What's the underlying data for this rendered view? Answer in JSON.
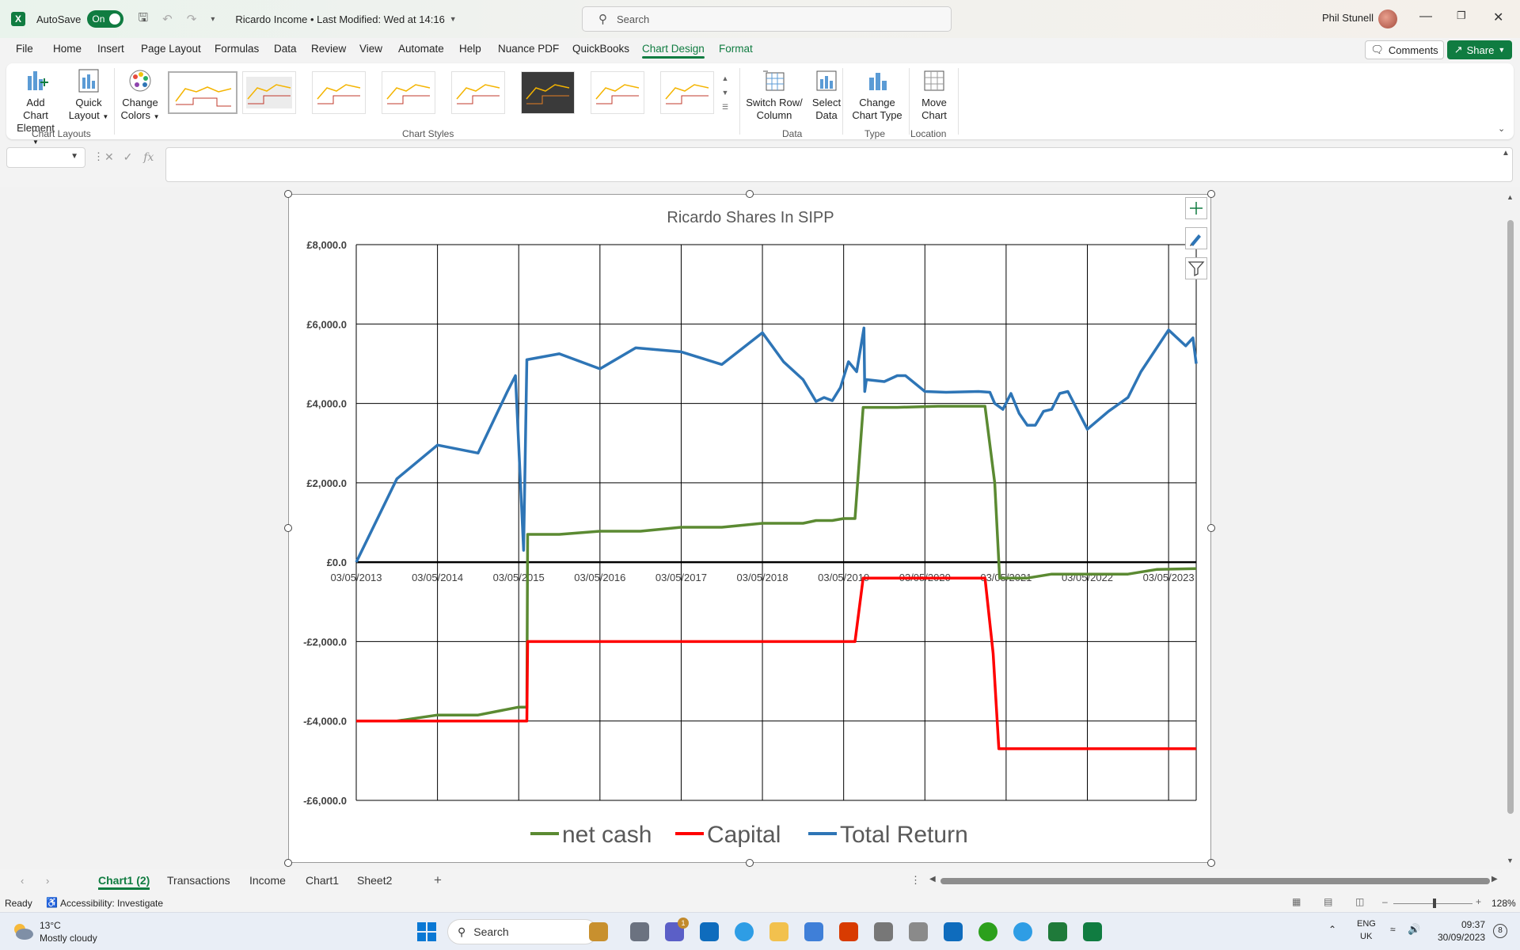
{
  "titlebar": {
    "autosave_label": "AutoSave",
    "autosave_state": "On",
    "doc_title": "Ricardo Income • Last Modified: Wed at 14:16",
    "search_placeholder": "Search",
    "user_name": "Phil Stunell"
  },
  "menu": {
    "tabs": [
      "File",
      "Home",
      "Insert",
      "Page Layout",
      "Formulas",
      "Data",
      "Review",
      "View",
      "Automate",
      "Help",
      "Nuance PDF",
      "QuickBooks",
      "Chart Design",
      "Format"
    ],
    "active_tab": "Chart Design",
    "comments_label": "Comments",
    "share_label": "Share"
  },
  "ribbon": {
    "add_chart_element": [
      "Add Chart",
      "Element"
    ],
    "quick_layout": [
      "Quick",
      "Layout"
    ],
    "change_colors": [
      "Change",
      "Colors"
    ],
    "switch_row_col": [
      "Switch Row/",
      "Column"
    ],
    "select_data": [
      "Select",
      "Data"
    ],
    "change_chart_type": [
      "Change",
      "Chart Type"
    ],
    "move_chart": [
      "Move",
      "Chart"
    ],
    "groups": {
      "chart_layouts": "Chart Layouts",
      "chart_styles": "Chart Styles",
      "data": "Data",
      "type": "Type",
      "location": "Location"
    }
  },
  "formula_bar": {
    "fx": "fx",
    "value": ""
  },
  "chart_data": {
    "type": "line",
    "title": "Ricardo Shares In SIPP",
    "x_tick_labels": [
      "03/05/2013",
      "03/05/2014",
      "03/05/2015",
      "03/05/2016",
      "03/05/2017",
      "03/05/2018",
      "03/05/2019",
      "03/05/2020",
      "03/05/2021",
      "03/05/2022",
      "03/05/2023"
    ],
    "y_tick_labels": [
      "£8,000.0",
      "£6,000.0",
      "£4,000.0",
      "£2,000.0",
      "£0.0",
      "-£2,000.0",
      "-£4,000.0",
      "-£6,000.0"
    ],
    "ylim": [
      -6000,
      8000
    ],
    "xlim": [
      2013.34,
      2023.68
    ],
    "grid": true,
    "legend_position": "bottom",
    "series": [
      {
        "name": "net cash",
        "color": "#5b8a32",
        "points": [
          [
            2013.34,
            -4000
          ],
          [
            2013.84,
            -4000
          ],
          [
            2014.34,
            -3850
          ],
          [
            2014.84,
            -3850
          ],
          [
            2015.34,
            -3650
          ],
          [
            2015.44,
            -3650
          ],
          [
            2015.45,
            700
          ],
          [
            2015.84,
            700
          ],
          [
            2016.34,
            780
          ],
          [
            2016.84,
            780
          ],
          [
            2017.34,
            880
          ],
          [
            2017.84,
            880
          ],
          [
            2018.34,
            980
          ],
          [
            2018.84,
            980
          ],
          [
            2019.0,
            1050
          ],
          [
            2019.2,
            1050
          ],
          [
            2019.34,
            1100
          ],
          [
            2019.48,
            1100
          ],
          [
            2019.58,
            3900
          ],
          [
            2020.0,
            3900
          ],
          [
            2020.5,
            3930
          ],
          [
            2021.08,
            3930
          ],
          [
            2021.2,
            2000
          ],
          [
            2021.26,
            -400
          ],
          [
            2021.6,
            -400
          ],
          [
            2021.9,
            -300
          ],
          [
            2022.34,
            -300
          ],
          [
            2022.84,
            -300
          ],
          [
            2023.2,
            -180
          ],
          [
            2023.68,
            -160
          ]
        ]
      },
      {
        "name": "Capital",
        "color": "#ff0000",
        "points": [
          [
            2013.34,
            -4000
          ],
          [
            2014.34,
            -4000
          ],
          [
            2015.44,
            -4000
          ],
          [
            2015.45,
            -2000
          ],
          [
            2016.34,
            -2000
          ],
          [
            2017.34,
            -2000
          ],
          [
            2018.34,
            -2000
          ],
          [
            2019.48,
            -2000
          ],
          [
            2019.58,
            -400
          ],
          [
            2020.5,
            -400
          ],
          [
            2021.08,
            -400
          ],
          [
            2021.18,
            -2300
          ],
          [
            2021.25,
            -4700
          ],
          [
            2022.34,
            -4700
          ],
          [
            2023.68,
            -4700
          ]
        ]
      },
      {
        "name": "Total Return",
        "color": "#2e75b6",
        "points": [
          [
            2013.34,
            0
          ],
          [
            2013.84,
            2100
          ],
          [
            2014.34,
            2950
          ],
          [
            2014.84,
            2750
          ],
          [
            2015.2,
            4300
          ],
          [
            2015.3,
            4700
          ],
          [
            2015.4,
            300
          ],
          [
            2015.44,
            5100
          ],
          [
            2015.84,
            5250
          ],
          [
            2016.34,
            4870
          ],
          [
            2016.78,
            5400
          ],
          [
            2017.34,
            5300
          ],
          [
            2017.84,
            4980
          ],
          [
            2018.34,
            5780
          ],
          [
            2018.6,
            5050
          ],
          [
            2018.84,
            4600
          ],
          [
            2019.0,
            4050
          ],
          [
            2019.1,
            4150
          ],
          [
            2019.2,
            4070
          ],
          [
            2019.3,
            4400
          ],
          [
            2019.4,
            5050
          ],
          [
            2019.5,
            4800
          ],
          [
            2019.59,
            5900
          ],
          [
            2019.6,
            4300
          ],
          [
            2019.62,
            4600
          ],
          [
            2019.84,
            4550
          ],
          [
            2020.0,
            4700
          ],
          [
            2020.1,
            4700
          ],
          [
            2020.34,
            4300
          ],
          [
            2020.6,
            4280
          ],
          [
            2021.0,
            4300
          ],
          [
            2021.14,
            4280
          ],
          [
            2021.2,
            4000
          ],
          [
            2021.3,
            3850
          ],
          [
            2021.4,
            4250
          ],
          [
            2021.5,
            3750
          ],
          [
            2021.6,
            3450
          ],
          [
            2021.7,
            3450
          ],
          [
            2021.8,
            3800
          ],
          [
            2021.9,
            3850
          ],
          [
            2022.0,
            4250
          ],
          [
            2022.1,
            4300
          ],
          [
            2022.34,
            3350
          ],
          [
            2022.6,
            3800
          ],
          [
            2022.84,
            4150
          ],
          [
            2023.0,
            4800
          ],
          [
            2023.34,
            5850
          ],
          [
            2023.55,
            5450
          ],
          [
            2023.64,
            5650
          ],
          [
            2023.68,
            5000
          ]
        ]
      }
    ]
  },
  "sheet_tabs": [
    "Chart1 (2)",
    "Transactions",
    "Income",
    "Chart1",
    "Sheet2"
  ],
  "status": {
    "ready": "Ready",
    "accessibility": "Accessibility: Investigate",
    "zoom": "128%"
  },
  "taskbar": {
    "weather_temp": "13°C",
    "weather_desc": "Mostly cloudy",
    "search_label": "Search",
    "lang_1": "ENG",
    "lang_2": "UK",
    "time": "09:37",
    "date": "30/09/2023",
    "notif_count": "8",
    "teams_badge": "1"
  }
}
